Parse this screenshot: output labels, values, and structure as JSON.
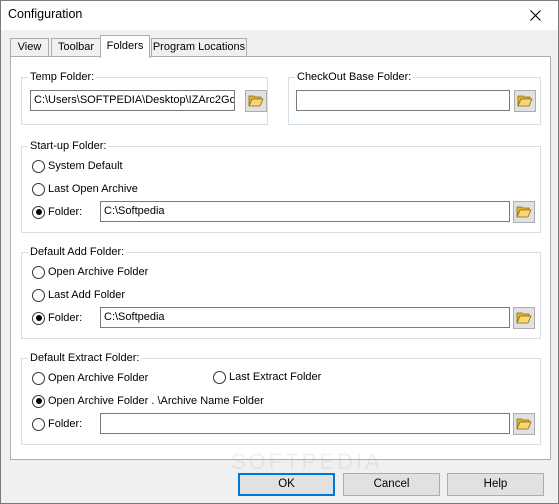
{
  "window": {
    "title": "Configuration",
    "close_symbol": "✕"
  },
  "tabs": [
    {
      "label": "View"
    },
    {
      "label": "Toolbar"
    },
    {
      "label": "Folders"
    },
    {
      "label": "Program Locations"
    }
  ],
  "temp_folder": {
    "title": "Temp Folder:",
    "value": "C:\\Users\\SOFTPEDIA\\Desktop\\IZArc2Go"
  },
  "checkout_folder": {
    "title": "CheckOut Base Folder:",
    "value": ""
  },
  "startup_folder": {
    "title": "Start-up Folder:",
    "options": [
      "System Default",
      "Last Open Archive",
      "Folder:"
    ],
    "selected": "Folder:",
    "value": "C:\\Softpedia"
  },
  "add_folder": {
    "title": "Default Add Folder:",
    "options": [
      "Open Archive Folder",
      "Last Add Folder",
      "Folder:"
    ],
    "selected": "Folder:",
    "value": "C:\\Softpedia"
  },
  "extract_folder": {
    "title": "Default Extract Folder:",
    "options": [
      "Open Archive Folder",
      "Last Extract Folder",
      "Open Archive Folder . \\Archive Name Folder",
      "Folder:"
    ],
    "selected": "Open Archive Folder . \\Archive Name Folder",
    "value": ""
  },
  "buttons": {
    "ok": "OK",
    "cancel": "Cancel",
    "help": "Help"
  },
  "watermark": "SOFTPEDIA",
  "colors": {
    "accent": "#0078d7",
    "folder": "#f2c94c"
  }
}
